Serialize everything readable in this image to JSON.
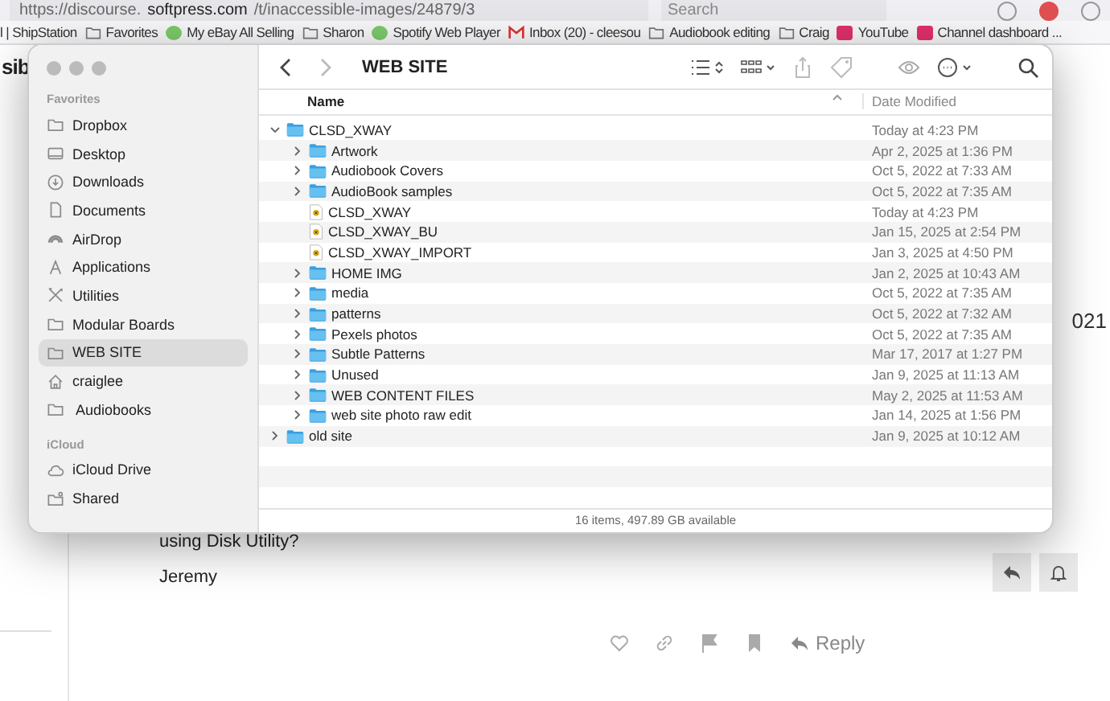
{
  "browser": {
    "address": "https://discourse.**softpress.com**/t/inaccessible-images/24879/3",
    "search": {
      "placeholder": "Search"
    },
    "bookmarks": [
      {
        "label": "l | ShipStation",
        "kind": "plain"
      },
      {
        "label": "Favorites",
        "kind": "folder"
      },
      {
        "label": "My eBay All Selling",
        "kind": "site"
      },
      {
        "label": "Sharon",
        "kind": "folder"
      },
      {
        "label": "Spotify Web Player",
        "kind": "site"
      },
      {
        "label": "Inbox (20) - cleesou",
        "kind": "mail"
      },
      {
        "label": "Audiobook editing",
        "kind": "folder"
      },
      {
        "label": "Craig",
        "kind": "folder"
      },
      {
        "label": "YouTube",
        "kind": "video"
      },
      {
        "label": "Channel dashboard ...",
        "kind": "video"
      }
    ]
  },
  "page": {
    "heading": "sib",
    "side_text": "021",
    "post_lines": [
      "using Disk Utility?",
      "Jeremy"
    ],
    "reply_label": "Reply"
  },
  "finder": {
    "title": "WEB SITE",
    "forward_disabled": true,
    "sidebar": [
      {
        "heading": "Favorites",
        "items": [
          {
            "label": "Dropbox",
            "kind": "folder",
            "selected": false
          },
          {
            "label": "Desktop",
            "kind": "desktop",
            "selected": false
          },
          {
            "label": "Downloads",
            "kind": "downloads",
            "selected": false
          },
          {
            "label": "Documents",
            "kind": "document",
            "selected": false
          },
          {
            "label": "AirDrop",
            "kind": "airdrop",
            "selected": false
          },
          {
            "label": "Applications",
            "kind": "applications",
            "selected": false
          },
          {
            "label": "Utilities",
            "kind": "utilities",
            "selected": false
          },
          {
            "label": "Modular Boards",
            "kind": "folder",
            "selected": false
          },
          {
            "label": "WEB SITE",
            "kind": "folder",
            "selected": true
          },
          {
            "label": "craiglee",
            "kind": "home",
            "selected": false
          },
          {
            "label": " Audiobooks",
            "kind": "folder",
            "selected": false
          }
        ]
      },
      {
        "heading": "iCloud",
        "items": [
          {
            "label": "iCloud Drive",
            "kind": "cloud",
            "selected": false
          },
          {
            "label": "Shared",
            "kind": "shared",
            "selected": false
          }
        ]
      }
    ],
    "columns": [
      "Name",
      "Date Modified"
    ],
    "files": [
      {
        "name": "CLSD_XWAY",
        "date": "Today at 4:23 PM",
        "kind": "folder",
        "expanded": true,
        "children": [
          {
            "name": "Artwork",
            "date": "Apr 2, 2025 at 1:36 PM",
            "kind": "folder",
            "expanded": false
          },
          {
            "name": "Audiobook Covers",
            "date": "Oct 5, 2022 at 7:33 AM",
            "kind": "folder",
            "expanded": false
          },
          {
            "name": "AudioBook samples",
            "date": "Oct 5, 2022 at 7:35 AM",
            "kind": "folder",
            "expanded": false
          },
          {
            "name": "CLSD_XWAY",
            "date": "Today at 4:23 PM",
            "kind": "document"
          },
          {
            "name": "CLSD_XWAY_BU",
            "date": "Jan 15, 2025 at 2:54 PM",
            "kind": "document"
          },
          {
            "name": "CLSD_XWAY_IMPORT",
            "date": "Jan 3, 2025 at 4:50 PM",
            "kind": "document"
          },
          {
            "name": "HOME IMG",
            "date": "Jan 2, 2025 at 10:43 AM",
            "kind": "folder",
            "expanded": false
          },
          {
            "name": "media",
            "date": "Oct 5, 2022 at 7:35 AM",
            "kind": "folder",
            "expanded": false
          },
          {
            "name": "patterns",
            "date": "Oct 5, 2022 at 7:32 AM",
            "kind": "folder",
            "expanded": false
          },
          {
            "name": "Pexels photos",
            "date": "Oct 5, 2022 at 7:35 AM",
            "kind": "folder",
            "expanded": false
          },
          {
            "name": "Subtle Patterns",
            "date": "Mar 17, 2017 at 1:27 PM",
            "kind": "folder",
            "expanded": false
          },
          {
            "name": "Unused",
            "date": "Jan 9, 2025 at 11:13 AM",
            "kind": "folder",
            "expanded": false
          },
          {
            "name": "WEB CONTENT FILES",
            "date": "May 2, 2025 at 11:53 AM",
            "kind": "folder",
            "expanded": false
          },
          {
            "name": "web site photo raw edit",
            "date": "Jan 14, 2025 at 1:56 PM",
            "kind": "folder",
            "expanded": false
          }
        ]
      },
      {
        "name": "old site",
        "date": "Jan 9, 2025 at 10:12 AM",
        "kind": "folder",
        "expanded": false
      }
    ],
    "status": "16 items, 497.89 GB available"
  }
}
